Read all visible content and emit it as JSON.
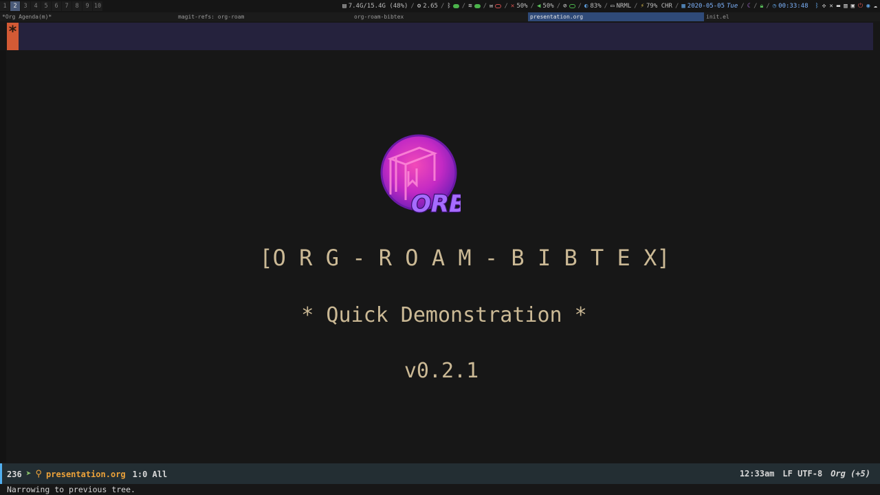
{
  "topbar": {
    "workspaces": [
      "1",
      "2",
      "3",
      "4",
      "5",
      "6",
      "7",
      "8",
      "9",
      "10"
    ],
    "active_workspace": "2",
    "memory": "7.4G/15.4G (48%)",
    "load": "2.65",
    "volume": "50%",
    "mic": "50%",
    "brightness": "83%",
    "power_profile": "NRML",
    "battery": "79% CHR",
    "date": "2020-05-05",
    "day": "Tue",
    "time": "00:33:48"
  },
  "tabs": [
    {
      "label": "*Org Agenda(m)*",
      "active": false
    },
    {
      "label": "magit-refs: org-roam",
      "active": false
    },
    {
      "label": "org-roam-bibtex",
      "active": false
    },
    {
      "label": "presentation.org",
      "active": true
    },
    {
      "label": "init.el",
      "active": false
    }
  ],
  "header": {
    "marker": "*"
  },
  "buffer": {
    "logo_text": "ORB",
    "title": "[O R G - R O A M - B I B T E X]",
    "subtitle": "* Quick Demonstration *",
    "version": "v0.2.1"
  },
  "modeline": {
    "line_count": "236",
    "filename": "presentation.org",
    "position": "1:0 All",
    "time": "12:33am",
    "encoding": "LF UTF-8",
    "mode": "Org (+5)"
  },
  "echo": "Narrowing to previous tree.",
  "colors": {
    "background": "#171717",
    "accent_orange": "#d35a35",
    "header_bg": "#25223d",
    "modeline_bg": "#232e33",
    "filename": "#eca23a",
    "title_text": "#cbb995",
    "active_tab": "#2f4a78"
  }
}
